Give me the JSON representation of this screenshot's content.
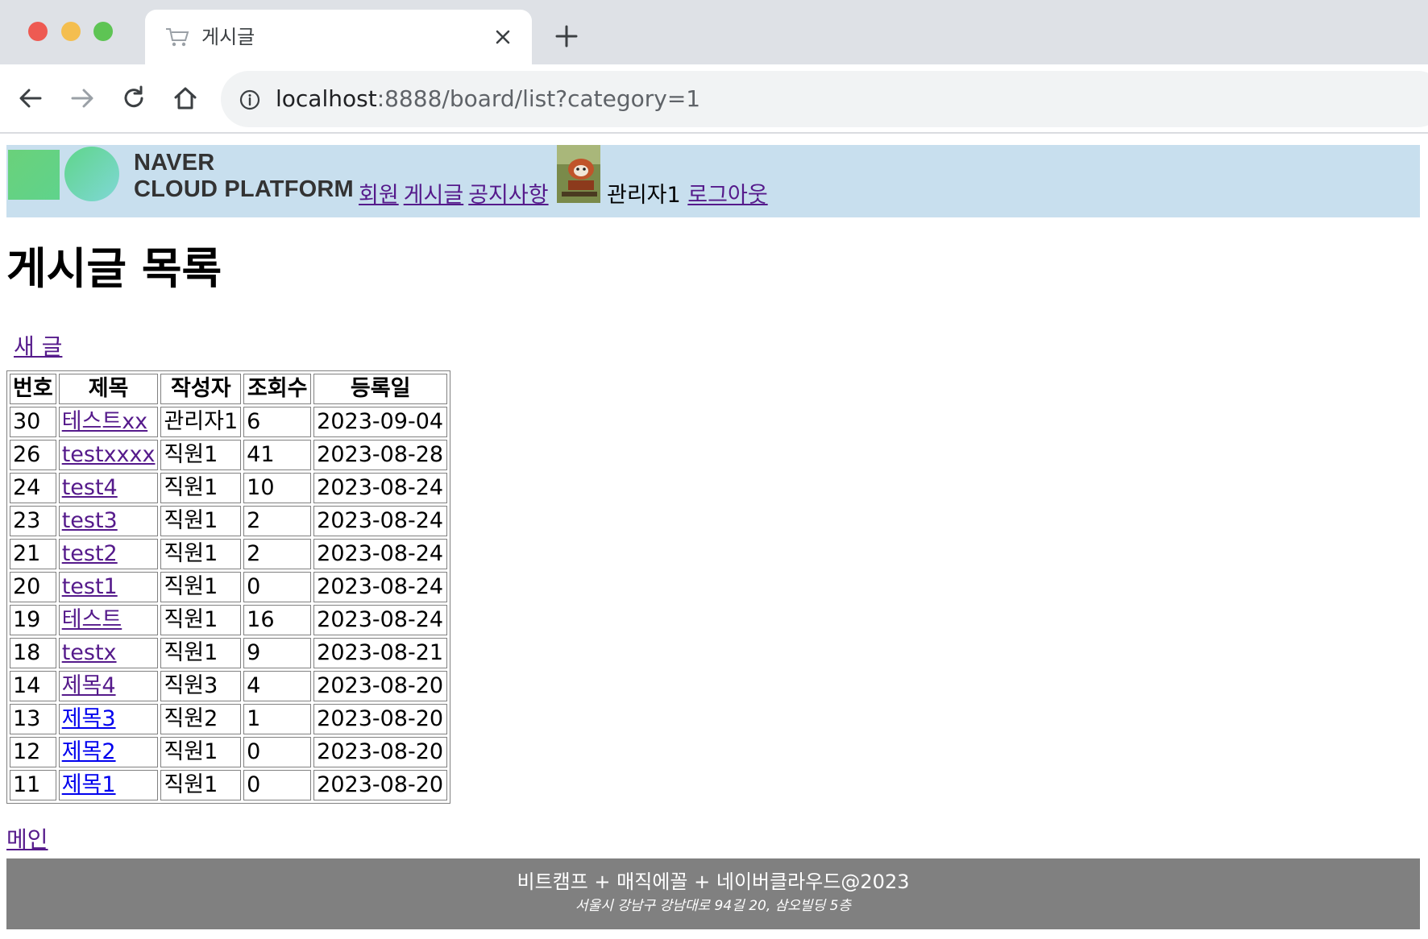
{
  "browser": {
    "tab_title": "게시글",
    "url_host": "localhost",
    "url_rest": ":8888/board/list?category=1"
  },
  "header": {
    "logo_line1": "NAVER",
    "logo_line2": "CLOUD PLATFORM",
    "nav": {
      "members": "회원",
      "board": "게시글",
      "notices": "공지사항"
    },
    "user_name": "관리자1",
    "logout": "로그아웃"
  },
  "main": {
    "title": "게시글 목록",
    "new_post": "새 글",
    "columns": [
      "번호",
      "제목",
      "작성자",
      "조회수",
      "등록일"
    ],
    "rows": [
      {
        "no": "30",
        "title": "테스트xx",
        "author": "관리자1",
        "views": "6",
        "date": "2023-09-04",
        "visited": true
      },
      {
        "no": "26",
        "title": "testxxxx",
        "author": "직원1",
        "views": "41",
        "date": "2023-08-28",
        "visited": true
      },
      {
        "no": "24",
        "title": "test4",
        "author": "직원1",
        "views": "10",
        "date": "2023-08-24",
        "visited": true
      },
      {
        "no": "23",
        "title": "test3",
        "author": "직원1",
        "views": "2",
        "date": "2023-08-24",
        "visited": true
      },
      {
        "no": "21",
        "title": "test2",
        "author": "직원1",
        "views": "2",
        "date": "2023-08-24",
        "visited": true
      },
      {
        "no": "20",
        "title": "test1",
        "author": "직원1",
        "views": "0",
        "date": "2023-08-24",
        "visited": true
      },
      {
        "no": "19",
        "title": "테스트",
        "author": "직원1",
        "views": "16",
        "date": "2023-08-24",
        "visited": true
      },
      {
        "no": "18",
        "title": "testx",
        "author": "직원1",
        "views": "9",
        "date": "2023-08-21",
        "visited": true
      },
      {
        "no": "14",
        "title": "제목4",
        "author": "직원3",
        "views": "4",
        "date": "2023-08-20",
        "visited": true
      },
      {
        "no": "13",
        "title": "제목3",
        "author": "직원2",
        "views": "1",
        "date": "2023-08-20",
        "visited": false
      },
      {
        "no": "12",
        "title": "제목2",
        "author": "직원1",
        "views": "0",
        "date": "2023-08-20",
        "visited": false
      },
      {
        "no": "11",
        "title": "제목1",
        "author": "직원1",
        "views": "0",
        "date": "2023-08-20",
        "visited": false
      }
    ],
    "main_link": "메인"
  },
  "footer": {
    "line1": "비트캠프 + 매직에꼴 + 네이버클라우드@2023",
    "line2": "서울시 강남구 강남대로 94길 20, 삼오빌딩 5층"
  },
  "colors": {
    "header_bg": "#c8dfee",
    "footer_bg": "#808080",
    "visited_link": "#551a8b",
    "unvisited_link": "#0000ee"
  }
}
